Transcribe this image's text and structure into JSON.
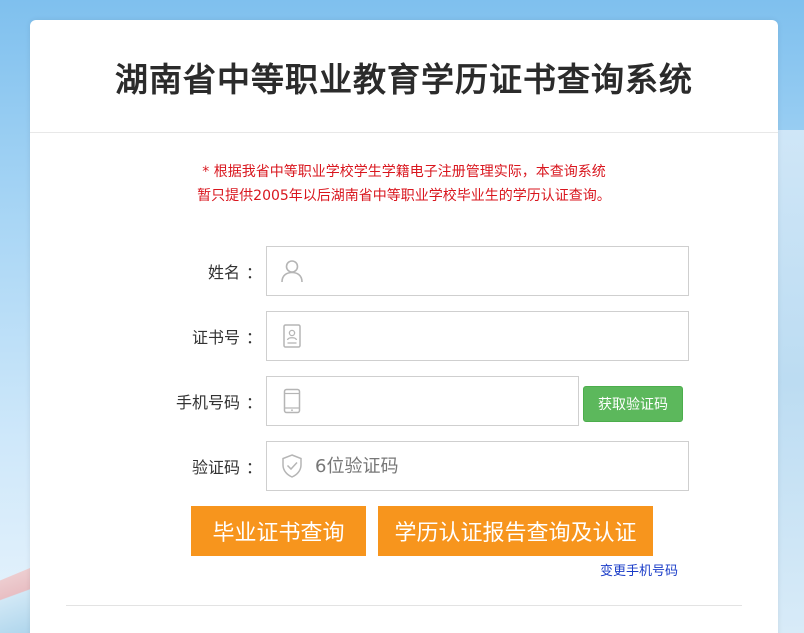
{
  "title": "湖南省中等职业教育学历证书查询系统",
  "notice": {
    "line1": "* 根据我省中等职业学校学生学籍电子注册管理实际，本查询系统",
    "line2": "暂只提供2005年以后湖南省中等职业学校毕业生的学历认证查询。"
  },
  "form": {
    "name": {
      "label": "姓名",
      "colon": "：",
      "icon": "user-icon",
      "placeholder": ""
    },
    "cert": {
      "label": "证书号",
      "colon": "：",
      "icon": "id-card-icon",
      "placeholder": ""
    },
    "phone": {
      "label": "手机号码",
      "colon": "：",
      "icon": "mobile-phone-icon",
      "placeholder": ""
    },
    "code": {
      "label": "验证码",
      "colon": "：",
      "icon": "shield-check-icon",
      "placeholder": "6位验证码"
    }
  },
  "buttons": {
    "get_code": "获取验证码",
    "query_cert": "毕业证书查询",
    "query_report": "学历认证报告查询及认证"
  },
  "links": {
    "change_phone": "变更手机号码"
  },
  "colors": {
    "notice_red": "#d9161e",
    "orange": "#f7951d",
    "green": "#5cb85c",
    "link_blue": "#1a3cc8"
  }
}
